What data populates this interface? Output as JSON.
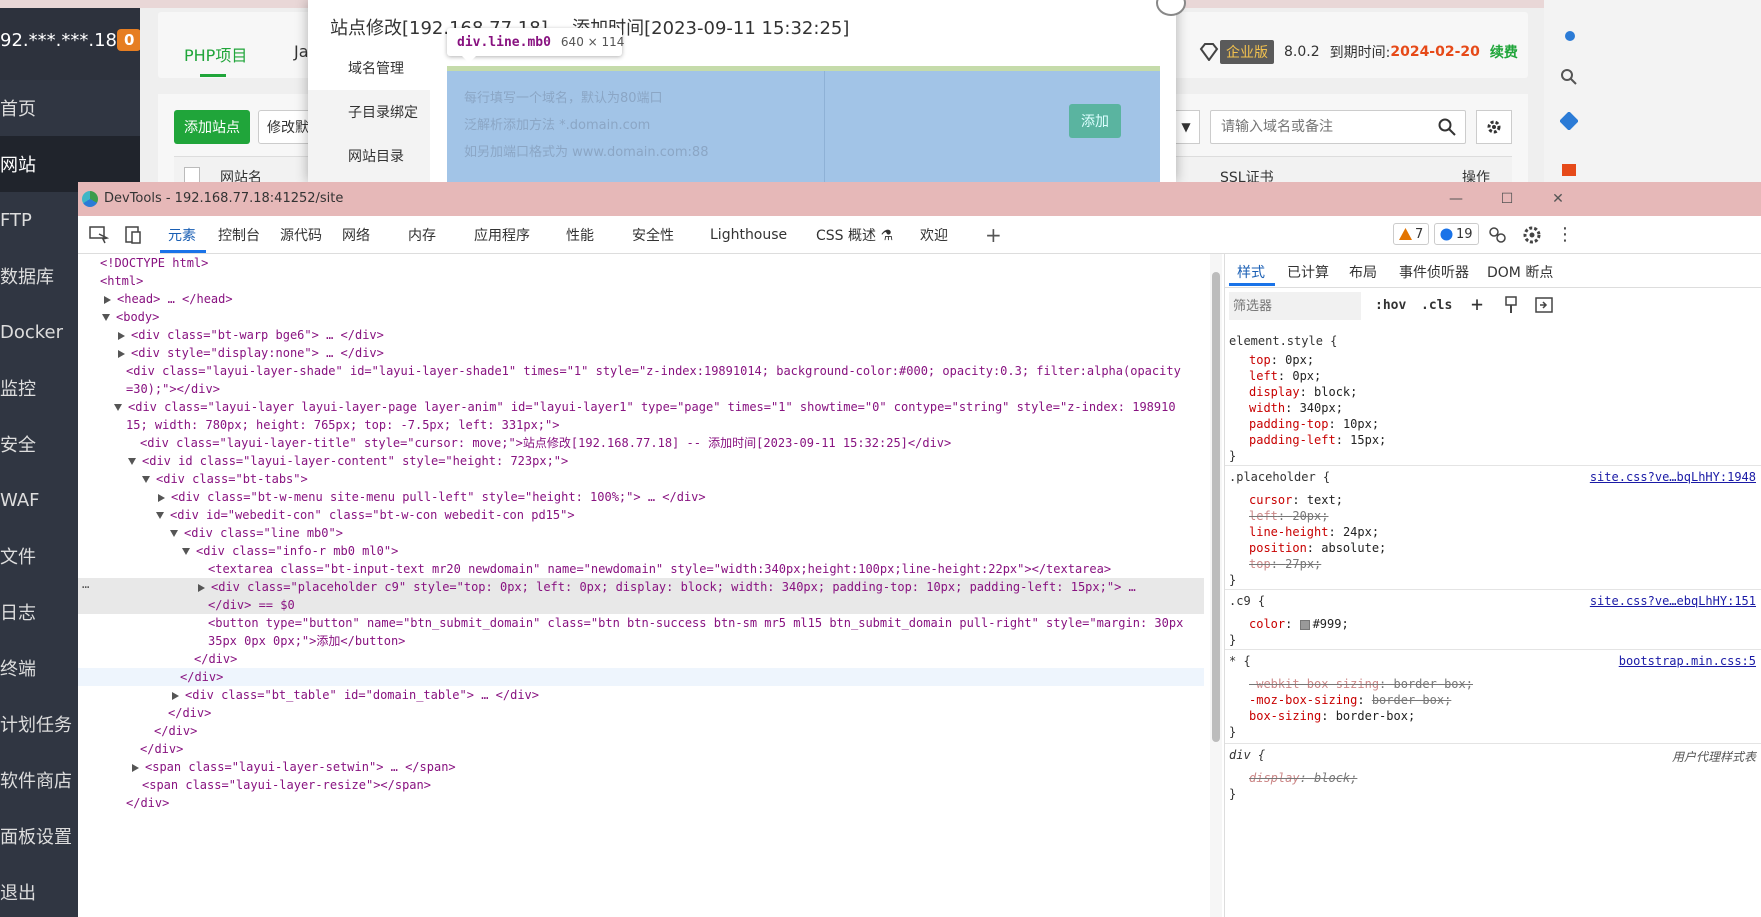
{
  "app": {
    "server": "92.***.***.18",
    "server_badge": "0",
    "nav": [
      "首页",
      "网站",
      "FTP",
      "数据库",
      "Docker",
      "监控",
      "安全",
      "WAF",
      "文件",
      "日志",
      "终端",
      "计划任务",
      "软件商店",
      "面板设置",
      "退出"
    ],
    "tab_php": "PHP项目",
    "tab_java": "Ja",
    "edition": "企业版",
    "version": "8.0.2",
    "expire_label": "到期时间:",
    "expire_date": "2024-02-20",
    "renew": "续费",
    "add_site": "添加站点",
    "modify_default": "修改默",
    "search_placeholder": "请输入域名或备注",
    "col_site": "网站名",
    "col_ssl": "SSL证书",
    "col_ops": "操作"
  },
  "modal": {
    "title": "站点修改[192.168.77.18] -- 添加时间[2023-09-11 15:32:25]",
    "menu": [
      "域名管理",
      "子目录绑定",
      "网站目录"
    ],
    "placeholder_lines": [
      "每行填写一个域名，默认为80端口",
      "泛解析添加方法 *.domain.com",
      "如另加端口格式为 www.domain.com:88"
    ],
    "add_button": "添加"
  },
  "tooltip": {
    "tag": "div.line.mb0",
    "dims": "640 × 114"
  },
  "devtools": {
    "title": "DevTools - 192.168.77.18:41252/site",
    "tabs": [
      "元素",
      "控制台",
      "源代码",
      "网络",
      "内存",
      "应用程序",
      "性能",
      "安全性",
      "Lighthouse",
      "CSS 概述 ⚗",
      "欢迎"
    ],
    "warnings": "7",
    "messages": "19",
    "code": [
      "<!DOCTYPE html>",
      "<html>",
      "<head> … </head>",
      "<body>",
      "<div class=\"bt-warp bge6\"> … </div>",
      "<div style=\"display:none\"> … </div>",
      "<div class=\"layui-layer-shade\" id=\"layui-layer-shade1\" times=\"1\" style=\"z-index:19891014; background-color:#000; opacity:0.3; filter:alpha(opacity",
      "=30);\"></div>",
      "<div class=\"layui-layer layui-layer-page  layer-anim\" id=\"layui-layer1\" type=\"page\" times=\"1\" showtime=\"0\" contype=\"string\" style=\"z-index: 198910",
      "15; width: 780px; height: 765px; top: -7.5px; left: 331px;\">",
      "<div class=\"layui-layer-title\" style=\"cursor: move;\">站点修改[192.168.77.18] -- 添加时间[2023-09-11 15:32:25]</div>",
      "<div id class=\"layui-layer-content\" style=\"height: 723px;\">",
      "<div class=\"bt-tabs\">",
      "<div class=\"bt-w-menu site-menu pull-left\" style=\"height: 100%;\"> … </div>",
      "<div id=\"webedit-con\" class=\"bt-w-con webedit-con pd15\">",
      "<div class=\"line mb0\">",
      "<div class=\"info-r mb0  ml0\">",
      "<textarea class=\"bt-input-text mr20 newdomain\" name=\"newdomain\" style=\"width:340px;height:100px;line-height:22px\"></textarea>",
      "<div class=\"placeholder c9\" style=\"top: 0px; left: 0px; display: block; width: 340px; padding-top: 10px; padding-left: 15px;\"> … ",
      "</div> == $0",
      "<button type=\"button\" name=\"btn_submit_domain\" class=\"btn btn-success btn-sm mr5 ml15 btn_submit_domain  pull-right\" style=\"margin: 30px",
      "35px 0px 0px;\">添加</button>",
      "</div>",
      "</div>",
      "<div class=\"bt_table\" id=\"domain_table\"> … </div>",
      "</div>",
      "</div>",
      "</div>",
      "<span class=\"layui-layer-setwin\"> … </span>",
      "<span class=\"layui-layer-resize\"></span>",
      "</div>"
    ],
    "styles_tabs": [
      "样式",
      "已计算",
      "布局",
      "事件侦听器",
      "DOM 断点"
    ],
    "filter_placeholder": "筛选器",
    "hov": ":hov",
    "cls": ".cls",
    "rules": [
      {
        "selector": "element.style {",
        "source": "",
        "props": [
          [
            "top",
            "0px;"
          ],
          [
            "left",
            "0px;"
          ],
          [
            "display",
            "block;"
          ],
          [
            "width",
            "340px;"
          ],
          [
            "padding-top",
            "10px;"
          ],
          [
            "padding-left",
            "15px;"
          ]
        ]
      },
      {
        "selector": ".placeholder {",
        "source": "site.css?ve…bqLhHY:1948",
        "props": [
          [
            "cursor",
            "text;"
          ],
          [
            "left",
            "20px;"
          ],
          [
            "line-height",
            "24px;"
          ],
          [
            "position",
            "absolute;"
          ],
          [
            "top",
            "27px;"
          ]
        ]
      },
      {
        "selector": ".c9 {",
        "source": "site.css?ve…ebqLhHY:151",
        "props": [
          [
            "color",
            "#999;"
          ]
        ]
      },
      {
        "selector": "* {",
        "source": "bootstrap.min.css:5",
        "props": [
          [
            "-webkit-box-sizing",
            "border-box;"
          ],
          [
            "-moz-box-sizing",
            "border-box;"
          ],
          [
            "box-sizing",
            "border-box;"
          ]
        ]
      },
      {
        "selector": "div {",
        "source": "用户代理样式表",
        "props": [
          [
            "display",
            "block;"
          ]
        ]
      }
    ]
  }
}
